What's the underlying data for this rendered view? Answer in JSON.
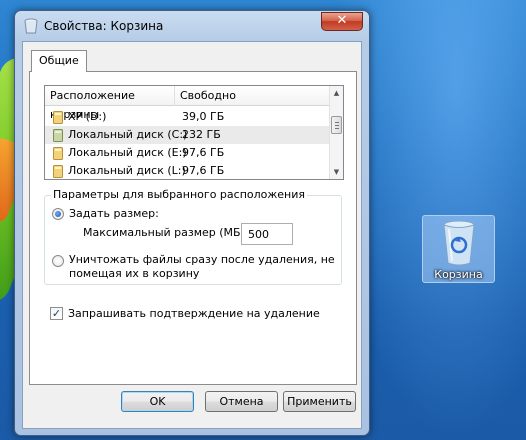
{
  "window": {
    "title": "Свойства: Корзина",
    "close_label": "✕",
    "tabs": [
      {
        "label": "Общие"
      }
    ]
  },
  "locations": {
    "columns": [
      "Расположение корзины",
      "Свободно"
    ],
    "rows": [
      {
        "name": "XP (D:)",
        "free": "39,0 ГБ",
        "selected": false
      },
      {
        "name": "Локальный диск (C:)",
        "free": "232 ГБ",
        "selected": true
      },
      {
        "name": "Локальный диск (E:)",
        "free": "97,6 ГБ",
        "selected": false
      },
      {
        "name": "Локальный диск (L:)",
        "free": "97,6 ГБ",
        "selected": false
      }
    ]
  },
  "settings": {
    "group_title": "Параметры для выбранного расположения",
    "custom_size_label": "Задать размер:",
    "max_size_label": "Максимальный размер (МБ):",
    "max_size_value": "500",
    "delete_immediately_line1": "Уничтожать файлы сразу после удаления, не",
    "delete_immediately_line2": "помещая их в корзину",
    "confirm_label": "Запрашивать подтверждение на удаление",
    "custom_size_checked": true,
    "confirm_checked": true
  },
  "buttons": {
    "ok": "OK",
    "cancel": "Отмена",
    "apply": "Применить"
  },
  "desktop": {
    "recycle_bin_label": "Корзина",
    "icon": "recycle-bin-icon"
  },
  "colors": {
    "desktop_blue": "#1f6fc0",
    "selection_gray": "#eaeaea",
    "close_red": "#c13a22"
  }
}
